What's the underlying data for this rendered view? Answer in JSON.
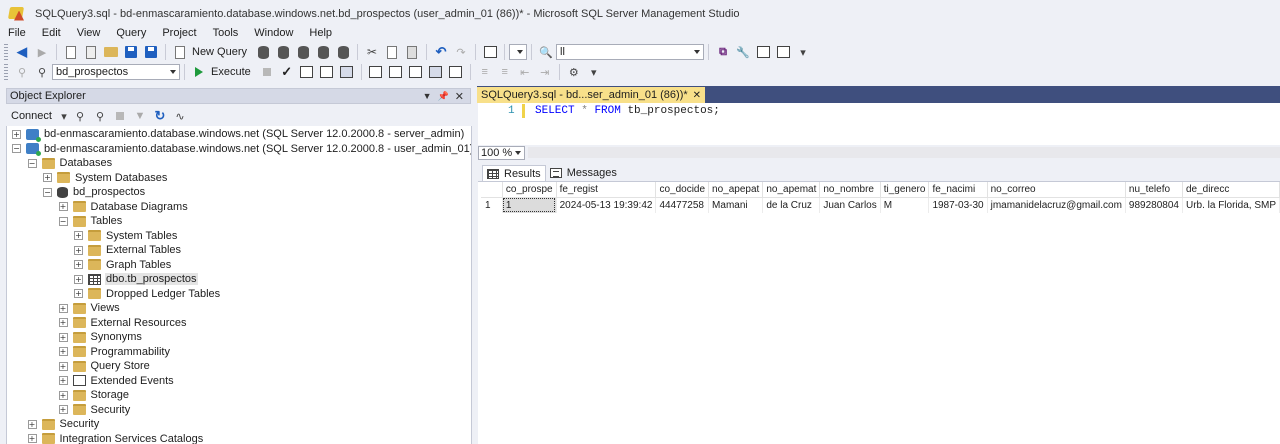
{
  "window": {
    "title": "SQLQuery3.sql - bd-enmascaramiento.database.windows.net.bd_prospectos (user_admin_01 (86))* - Microsoft SQL Server Management Studio"
  },
  "menu": [
    "File",
    "Edit",
    "View",
    "Query",
    "Project",
    "Tools",
    "Window",
    "Help"
  ],
  "toolbar": {
    "new_query_label": "New Query",
    "find_value": "ll",
    "database_selected": "bd_prospectos",
    "execute_label": "Execute"
  },
  "object_explorer": {
    "title": "Object Explorer",
    "connect_label": "Connect",
    "tree": [
      {
        "label": "bd-enmascaramiento.database.windows.net (SQL Server 12.0.2000.8 - server_admin)",
        "level": 0,
        "expander": "+",
        "icon": "server"
      },
      {
        "label": "bd-enmascaramiento.database.windows.net (SQL Server 12.0.2000.8 - user_admin_01)",
        "level": 0,
        "expander": "−",
        "icon": "server"
      },
      {
        "label": "Databases",
        "level": 1,
        "expander": "−",
        "icon": "folder"
      },
      {
        "label": "System Databases",
        "level": 2,
        "expander": "+",
        "icon": "folder"
      },
      {
        "label": "bd_prospectos",
        "level": 2,
        "expander": "−",
        "icon": "db"
      },
      {
        "label": "Database Diagrams",
        "level": 3,
        "expander": "+",
        "icon": "folder"
      },
      {
        "label": "Tables",
        "level": 3,
        "expander": "−",
        "icon": "folder"
      },
      {
        "label": "System Tables",
        "level": 4,
        "expander": "+",
        "icon": "folder"
      },
      {
        "label": "External Tables",
        "level": 4,
        "expander": "+",
        "icon": "folder"
      },
      {
        "label": "Graph Tables",
        "level": 4,
        "expander": "+",
        "icon": "folder"
      },
      {
        "label": "dbo.tb_prospectos",
        "level": 4,
        "expander": "+",
        "icon": "table",
        "selected": true
      },
      {
        "label": "Dropped Ledger Tables",
        "level": 4,
        "expander": "+",
        "icon": "folder"
      },
      {
        "label": "Views",
        "level": 3,
        "expander": "+",
        "icon": "folder"
      },
      {
        "label": "External Resources",
        "level": 3,
        "expander": "+",
        "icon": "folder"
      },
      {
        "label": "Synonyms",
        "level": 3,
        "expander": "+",
        "icon": "folder"
      },
      {
        "label": "Programmability",
        "level": 3,
        "expander": "+",
        "icon": "folder"
      },
      {
        "label": "Query Store",
        "level": 3,
        "expander": "+",
        "icon": "folder"
      },
      {
        "label": "Extended Events",
        "level": 3,
        "expander": "+",
        "icon": "events"
      },
      {
        "label": "Storage",
        "level": 3,
        "expander": "+",
        "icon": "folder"
      },
      {
        "label": "Security",
        "level": 3,
        "expander": "+",
        "icon": "folder"
      },
      {
        "label": "Security",
        "level": 1,
        "expander": "+",
        "icon": "folder"
      },
      {
        "label": "Integration Services Catalogs",
        "level": 1,
        "expander": "+",
        "icon": "folder"
      }
    ]
  },
  "editor": {
    "tab_label": "SQLQuery3.sql - bd...ser_admin_01 (86))*",
    "line_number": "1",
    "code": {
      "kw1": "SELECT",
      "op": "*",
      "kw2": "FROM",
      "ident": "tb_prospectos;"
    },
    "zoom": "100 %"
  },
  "results": {
    "tabs": [
      "Results",
      "Messages"
    ],
    "columns": [
      "co_prospe",
      "fe_regist",
      "co_docide",
      "no_apepat",
      "no_apemat",
      "no_nombre",
      "ti_genero",
      "fe_nacimi",
      "no_correo",
      "nu_telefo",
      "de_direcc"
    ],
    "rows": [
      {
        "rownum": "1",
        "cells": [
          "1",
          "2024-05-13 19:39:42",
          "44477258",
          "Mamani",
          "de la Cruz",
          "Juan Carlos",
          "M",
          "1987-03-30",
          "jmamanidelacruz@gmail.com",
          "989280804",
          "Urb. la Florida, SMP"
        ]
      }
    ]
  }
}
